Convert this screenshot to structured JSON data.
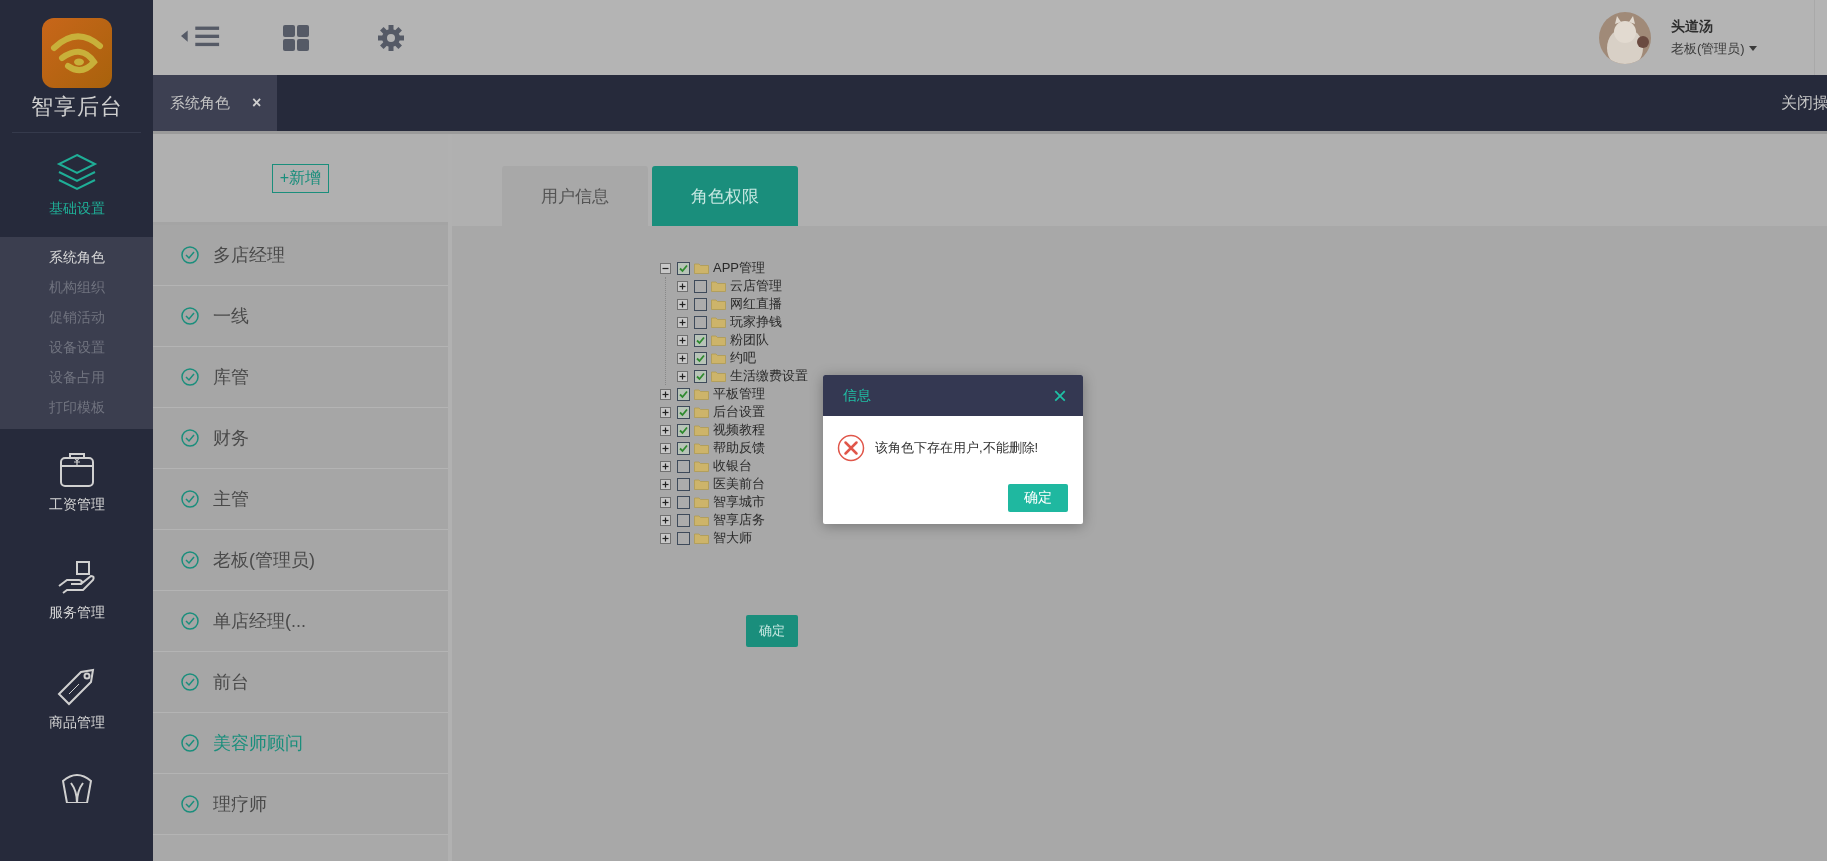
{
  "sidebar": {
    "logo_text": "智享后台",
    "menu": [
      {
        "label": "基础设置",
        "selected": true,
        "expanded": true,
        "children": [
          {
            "label": "系统角色",
            "selected": true
          },
          {
            "label": "机构组织",
            "selected": false
          },
          {
            "label": "促销活动",
            "selected": false
          },
          {
            "label": "设备设置",
            "selected": false
          },
          {
            "label": "设备占用",
            "selected": false
          },
          {
            "label": "打印模板",
            "selected": false
          }
        ]
      },
      {
        "label": "工资管理",
        "selected": false
      },
      {
        "label": "服务管理",
        "selected": false
      },
      {
        "label": "商品管理",
        "selected": false
      }
    ]
  },
  "user": {
    "name": "头道汤",
    "role": "老板(管理员)"
  },
  "open_tabs": [
    {
      "label": "系统角色",
      "close": "×"
    }
  ],
  "close_actions": "关闭操",
  "roles": {
    "add_button": "+新增",
    "items": [
      {
        "label": "多店经理",
        "selected": false
      },
      {
        "label": "一线",
        "selected": false
      },
      {
        "label": "库管",
        "selected": false
      },
      {
        "label": "财务",
        "selected": false
      },
      {
        "label": "主管",
        "selected": false
      },
      {
        "label": "老板(管理员)",
        "selected": false
      },
      {
        "label": "单店经理(...",
        "selected": false
      },
      {
        "label": "前台",
        "selected": false
      },
      {
        "label": "美容师顾问",
        "selected": true
      },
      {
        "label": "理疗师",
        "selected": false
      }
    ]
  },
  "detail_tabs": [
    {
      "label": "用户信息",
      "selected": false
    },
    {
      "label": "角色权限",
      "selected": true
    }
  ],
  "permissions": [
    {
      "label": "APP管理",
      "checked": true,
      "expanded": true,
      "children": [
        {
          "label": "云店管理",
          "checked": false,
          "expanded": false
        },
        {
          "label": "网红直播",
          "checked": false,
          "expanded": false
        },
        {
          "label": "玩家挣钱",
          "checked": false,
          "expanded": false
        },
        {
          "label": "粉团队",
          "checked": true,
          "expanded": false
        },
        {
          "label": "约吧",
          "checked": true,
          "expanded": false
        },
        {
          "label": "生活缴费设置",
          "checked": true,
          "expanded": false
        }
      ]
    },
    {
      "label": "平板管理",
      "checked": true,
      "expanded": false
    },
    {
      "label": "后台设置",
      "checked": true,
      "expanded": false
    },
    {
      "label": "视频教程",
      "checked": true,
      "expanded": false
    },
    {
      "label": "帮助反馈",
      "checked": true,
      "expanded": false
    },
    {
      "label": "收银台",
      "checked": false,
      "expanded": false
    },
    {
      "label": "医美前台",
      "checked": false,
      "expanded": false
    },
    {
      "label": "智享城市",
      "checked": false,
      "expanded": false
    },
    {
      "label": "智享店务",
      "checked": false,
      "expanded": false
    },
    {
      "label": "智大师",
      "checked": false,
      "expanded": false
    }
  ],
  "save_button": "确定",
  "dialog": {
    "title": "信息",
    "close": "×",
    "message": "该角色下存在用户,不能删除!",
    "button": "确定"
  }
}
